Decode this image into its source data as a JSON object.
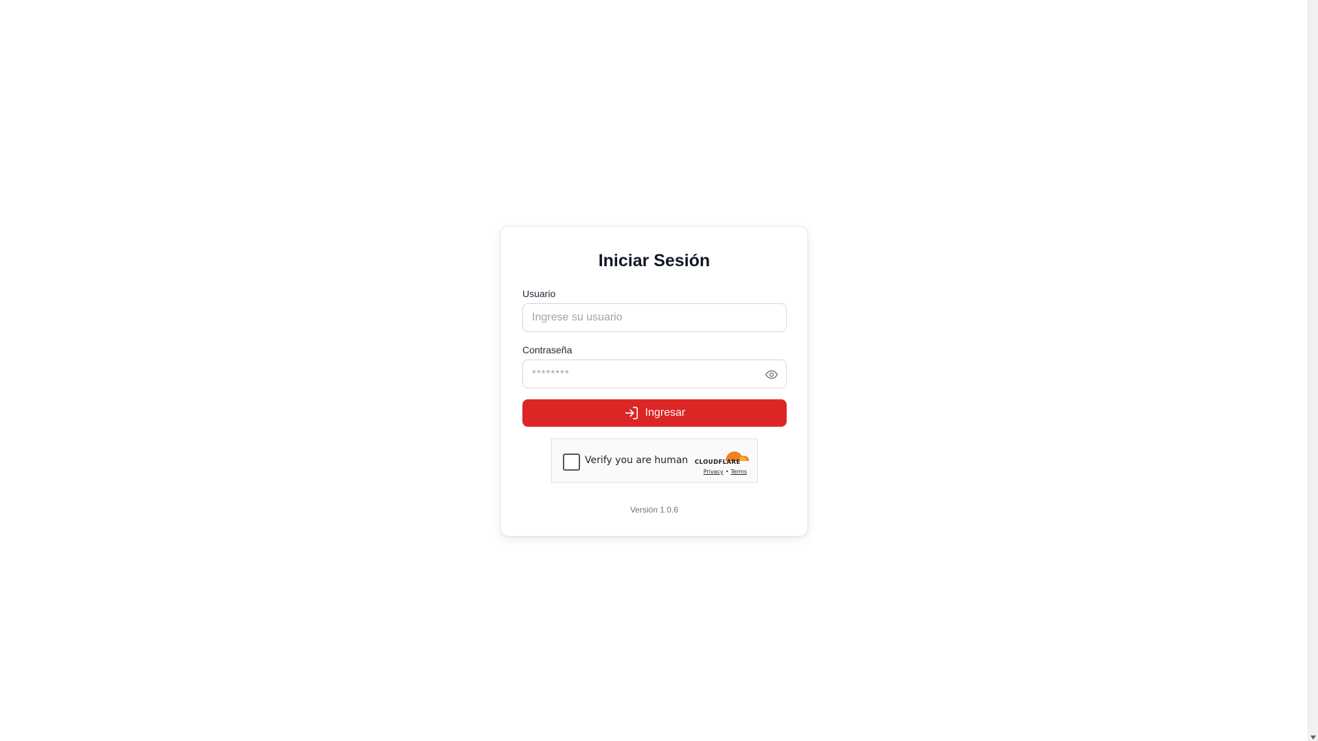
{
  "login": {
    "title": "Iniciar Sesión",
    "username_label": "Usuario",
    "username_placeholder": "Ingrese su usuario",
    "username_value": "",
    "password_label": "Contraseña",
    "password_placeholder": "********",
    "password_value": "",
    "password_toggle_icon": "eye-icon",
    "submit_label": "Ingresar",
    "submit_icon": "login-icon",
    "version": "Versión 1.0.6"
  },
  "captcha": {
    "label": "Verify you are human",
    "brand": "CLOUDFLARE",
    "privacy_link": "Privacy",
    "separator": "•",
    "terms_link": "Terms",
    "checked": false
  },
  "colors": {
    "primary": "#dc2626",
    "cloudflare_orange": "#f38020",
    "cloudflare_light_orange": "#faae40"
  }
}
